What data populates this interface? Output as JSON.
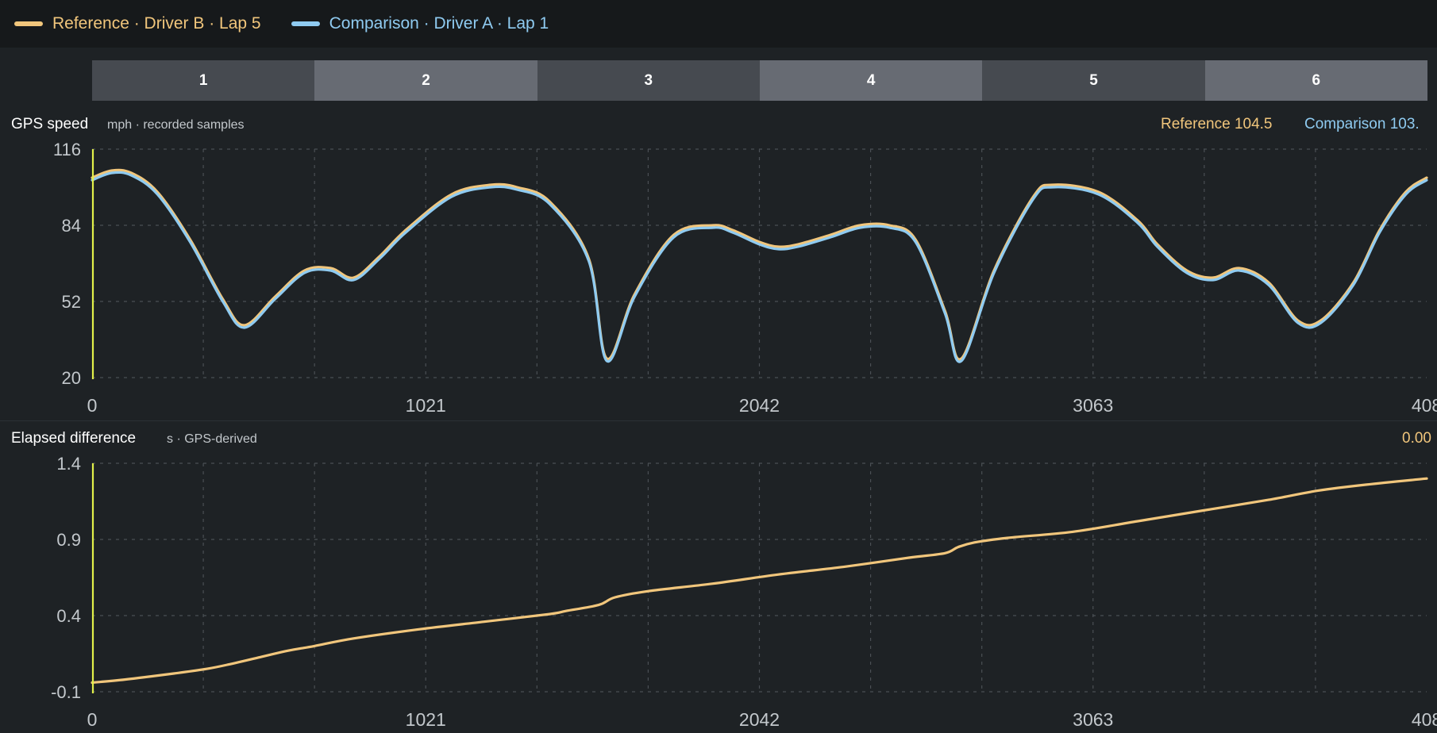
{
  "legend": {
    "reference": {
      "label": "Reference · Driver B · Lap 5",
      "color": "#f1c67c"
    },
    "comparison": {
      "label": "Comparison · Driver A · Lap 1",
      "color": "#8fcbf1"
    }
  },
  "sectors": [
    "1",
    "2",
    "3",
    "4",
    "5",
    "6"
  ],
  "speed_panel": {
    "title": "GPS speed",
    "subtitle": "mph · recorded samples",
    "readout_reference": "Reference 104.5",
    "readout_comparison": "Comparison 103.",
    "yticks": [
      "116",
      "84",
      "52",
      "20"
    ],
    "xticks": [
      "0",
      "1021",
      "2042",
      "3063",
      "408"
    ]
  },
  "delta_panel": {
    "title": "Elapsed difference",
    "subtitle": "s · GPS-derived",
    "readout": "0.00",
    "yticks": [
      "1.4",
      "0.9",
      "0.4",
      "-0.1"
    ],
    "xticks": [
      "0",
      "1021",
      "2042",
      "3063",
      "408"
    ]
  },
  "chart_data": [
    {
      "type": "line",
      "title": "GPS speed",
      "ylabel": "mph",
      "xlim": [
        0,
        4084
      ],
      "ylim": [
        20,
        116
      ],
      "x": [
        0,
        60,
        120,
        200,
        300,
        400,
        466,
        560,
        650,
        730,
        800,
        880,
        960,
        1100,
        1220,
        1300,
        1400,
        1520,
        1575,
        1660,
        1780,
        1900,
        1960,
        2042,
        2100,
        2160,
        2260,
        2350,
        2440,
        2520,
        2610,
        2660,
        2760,
        2880,
        2940,
        3080,
        3200,
        3260,
        3350,
        3430,
        3510,
        3600,
        3690,
        3760,
        3860,
        3940,
        4020,
        4084
      ],
      "series": [
        {
          "name": "Reference · Driver B · Lap 5",
          "values": [
            104,
            107,
            106,
            98,
            78,
            53,
            42,
            54,
            65,
            66,
            62,
            71,
            82,
            97,
            101,
            100,
            94,
            70,
            28,
            55,
            80,
            84,
            82,
            77,
            75,
            76,
            80,
            84,
            84,
            78,
            48,
            28,
            65,
            96,
            101,
            98,
            86,
            76,
            65,
            62,
            66,
            60,
            44,
            44,
            60,
            82,
            98,
            104
          ]
        },
        {
          "name": "Comparison · Driver A · Lap 1",
          "values": [
            103,
            106,
            105,
            97,
            77,
            52,
            41,
            53,
            64,
            65,
            61,
            70,
            81,
            96,
            100,
            99,
            93,
            69,
            27,
            54,
            79,
            83,
            81,
            76,
            74,
            75,
            79,
            83,
            83,
            77,
            47,
            27,
            64,
            95,
            100,
            97,
            85,
            75,
            64,
            61,
            65,
            59,
            43,
            43,
            59,
            81,
            97,
            103
          ]
        }
      ]
    },
    {
      "type": "line",
      "title": "Elapsed difference",
      "ylabel": "s",
      "xlim": [
        0,
        4084
      ],
      "ylim": [
        -0.1,
        1.4
      ],
      "x": [
        0,
        100,
        250,
        350,
        420,
        520,
        600,
        680,
        800,
        1000,
        1200,
        1400,
        1450,
        1550,
        1600,
        1700,
        1900,
        2100,
        2300,
        2500,
        2610,
        2650,
        2700,
        2800,
        3000,
        3200,
        3400,
        3600,
        3750,
        3900,
        4084
      ],
      "series": [
        {
          "name": "",
          "values": [
            -0.04,
            -0.02,
            0.02,
            0.05,
            0.08,
            0.13,
            0.17,
            0.2,
            0.25,
            0.31,
            0.36,
            0.41,
            0.43,
            0.47,
            0.52,
            0.56,
            0.61,
            0.67,
            0.72,
            0.78,
            0.81,
            0.85,
            0.88,
            0.91,
            0.95,
            1.02,
            1.09,
            1.16,
            1.22,
            1.26,
            1.3
          ]
        }
      ]
    }
  ],
  "style": {
    "background": "#1e2225",
    "cursor_color": "#e1f04a",
    "grid_color": "#4a4f54",
    "tick_color": "#c3c8cc"
  }
}
